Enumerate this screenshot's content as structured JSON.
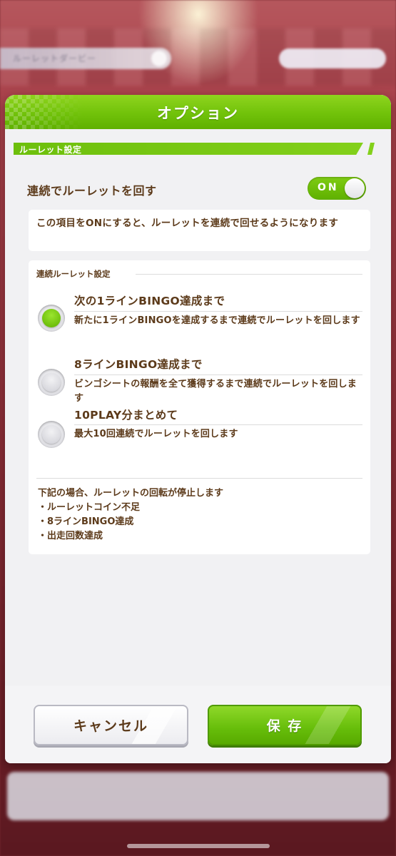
{
  "background": {
    "title_pill_text": "ルーレットダービー"
  },
  "modal": {
    "title": "オプション",
    "section_label": "ルーレット設定",
    "continuous": {
      "label": "連続でルーレットを回す",
      "toggle_text": "ON",
      "toggle_state": "on"
    },
    "info_text": "この項目をONにすると、ルーレットを連続で回せるようになります",
    "continuous_settings": {
      "subheading": "連続ルーレット設定",
      "options": [
        {
          "title": "次の1ラインBINGO達成まで",
          "description": "新たに1ラインBINGOを達成するまで連続でルーレットを回します",
          "selected": true
        },
        {
          "title": "8ラインBINGO達成まで",
          "description": "ビンゴシートの報酬を全て獲得するまで連続でルーレットを回します",
          "selected": false
        },
        {
          "title": "10PLAY分まとめて",
          "description": "最大10回連続でルーレットを回します",
          "selected": false
        }
      ],
      "notes": {
        "heading": "下記の場合、ルーレットの回転が停止します",
        "items": [
          "・ルーレットコイン不足",
          "・8ラインBINGO達成",
          "・出走回数達成"
        ]
      }
    },
    "buttons": {
      "cancel": "キャンセル",
      "save": "保 存"
    }
  },
  "colors": {
    "accent_green": "#6dbf0c",
    "text_brown": "#5c3a1a",
    "panel_bg": "#f1f1f3"
  }
}
